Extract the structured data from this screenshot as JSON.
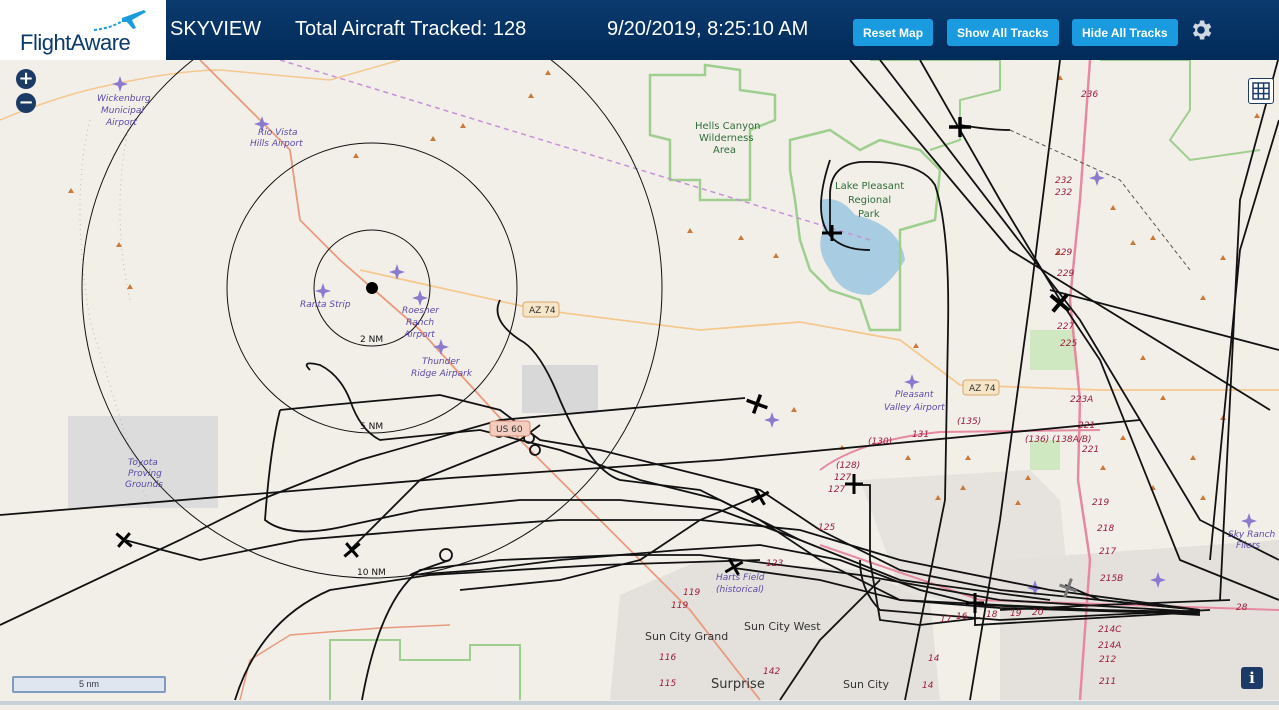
{
  "header": {
    "logo": "FlightAware",
    "product": "SKYVIEW",
    "total_tracked": "Total Aircraft Tracked: 128",
    "datetime": "9/20/2019, 8:25:10 AM",
    "buttons": {
      "reset": "Reset Map",
      "show": "Show All Tracks",
      "hide": "Hide All Tracks"
    }
  },
  "map": {
    "zoom_in": "+",
    "zoom_out": "−",
    "scale": "5 nm",
    "info": "i",
    "range_rings": {
      "r1": "2 NM",
      "r2": "5 NM",
      "r3": "10 NM"
    },
    "airports": {
      "wickenburg": [
        "Wickenburg",
        "Municipal",
        "Airport"
      ],
      "rio_vista": [
        "Rio Vista",
        "Hills Airport"
      ],
      "ranta": [
        "Ranta Strip"
      ],
      "roesner": [
        "Roesner",
        "Ranch",
        "Airport"
      ],
      "thunder": [
        "Thunder",
        "Ridge Airpark"
      ],
      "pleasant": [
        "Pleasant",
        "Valley Airport"
      ],
      "harts": [
        "Harts Field",
        "(historical)"
      ],
      "sky": [
        "Sky Ranch",
        "Fliers"
      ]
    },
    "areas": {
      "hells": [
        "Hells Canyon",
        "Wilderness",
        "Area"
      ],
      "lake": [
        "Lake Pleasant",
        "Regional",
        "Park"
      ],
      "toyota": [
        "Toyota",
        "Proving",
        "Grounds"
      ]
    },
    "cities": {
      "sun_city_grand": "Sun City Grand",
      "sun_city_west": "Sun City West",
      "surprise": "Surprise",
      "sun_city": "Sun City"
    },
    "roads": {
      "az74a": "AZ 74",
      "az74b": "AZ 74",
      "us60": "US 60"
    },
    "route_numbers": {
      "i236": "236",
      "i232a": "232",
      "i232b": "232",
      "i229a": "229",
      "i229b": "229",
      "i227": "227",
      "i225": "225",
      "i223a": "223A",
      "i221a": "221",
      "i221b": "221",
      "i219": "219",
      "i218": "218",
      "i217": "217",
      "i215b": "215B",
      "i214c": "214C",
      "i214a": "214A",
      "i212": "212",
      "i211": "211",
      "r128": "(128)",
      "r127": "127",
      "r130": "(130)",
      "r131": "131",
      "r135": "(135)",
      "r136": "(136)",
      "r138": "(138A/B)",
      "r125": "125",
      "r123": "123",
      "r119a": "119",
      "r119b": "119",
      "r116": "116",
      "r115": "115",
      "r142": "142",
      "r17": "17",
      "r16": "16",
      "r18": "18",
      "r19": "19",
      "r20": "20",
      "r14a": "14",
      "r14b": "14",
      "r28": "28"
    }
  }
}
